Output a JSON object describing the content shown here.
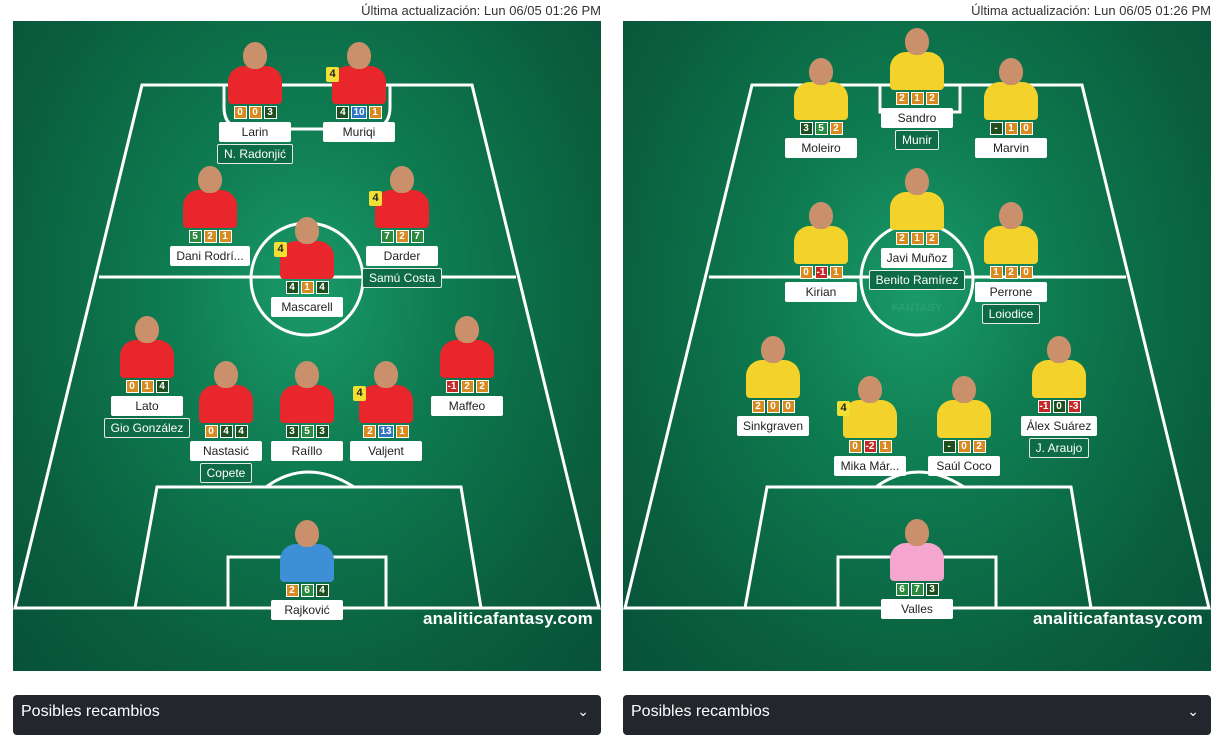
{
  "left_team": {
    "updated": "Última actualización: Lun 06/05 01:26 PM",
    "watermark": "analiticafantasy.com",
    "replacements_title": "Posibles recambios",
    "colors": {
      "shirt": "#e8262b",
      "gk_shirt": "#3d8fd6"
    },
    "players": [
      {
        "id": "larin",
        "name": "Larin",
        "stats": [
          "0",
          "0",
          "3"
        ],
        "classes": [
          "o",
          "o",
          "d"
        ],
        "alt": "N. Radonjić",
        "badge": "",
        "gk": false
      },
      {
        "id": "muriqi",
        "name": "Muriqi",
        "stats": [
          "4",
          "10",
          "1"
        ],
        "classes": [
          "d",
          "b",
          "o"
        ],
        "alt": "",
        "badge": "4",
        "gk": false
      },
      {
        "id": "dani",
        "name": "Dani Rodrí...",
        "stats": [
          "5",
          "2",
          "1"
        ],
        "classes": [
          "g",
          "o",
          "o"
        ],
        "alt": "",
        "badge": "",
        "gk": false
      },
      {
        "id": "darder",
        "name": "Darder",
        "stats": [
          "7",
          "2",
          "7"
        ],
        "classes": [
          "g",
          "o",
          "g"
        ],
        "alt": "Samú Costa",
        "badge": "4",
        "gk": false
      },
      {
        "id": "mascarell",
        "name": "Mascarell",
        "stats": [
          "4",
          "1",
          "4"
        ],
        "classes": [
          "d",
          "o",
          "d"
        ],
        "alt": "",
        "badge": "4",
        "gk": false
      },
      {
        "id": "lato",
        "name": "Lato",
        "stats": [
          "0",
          "1",
          "4"
        ],
        "classes": [
          "o",
          "o",
          "d"
        ],
        "alt": "Gio González",
        "badge": "",
        "gk": false
      },
      {
        "id": "maffeo",
        "name": "Maffeo",
        "stats": [
          "-1",
          "2",
          "2"
        ],
        "classes": [
          "r",
          "o",
          "o"
        ],
        "alt": "",
        "badge": "",
        "gk": false
      },
      {
        "id": "nastasic",
        "name": "Nastasić",
        "stats": [
          "0",
          "4",
          "4"
        ],
        "classes": [
          "o",
          "d",
          "d"
        ],
        "alt": "Copete",
        "badge": "",
        "gk": false
      },
      {
        "id": "raillo",
        "name": "Raíllo",
        "stats": [
          "3",
          "5",
          "3"
        ],
        "classes": [
          "d",
          "g",
          "d"
        ],
        "alt": "",
        "badge": "",
        "gk": false
      },
      {
        "id": "valjent",
        "name": "Valjent",
        "stats": [
          "2",
          "13",
          "1"
        ],
        "classes": [
          "o",
          "b",
          "o"
        ],
        "alt": "",
        "badge": "4",
        "gk": false
      },
      {
        "id": "rajkovic",
        "name": "Rajković",
        "stats": [
          "2",
          "6",
          "4"
        ],
        "classes": [
          "o",
          "g",
          "d"
        ],
        "alt": "",
        "badge": "",
        "gk": true
      }
    ]
  },
  "right_team": {
    "updated": "Última actualización: Lun 06/05 01:26 PM",
    "watermark": "analiticafantasy.com",
    "replacements_title": "Posibles recambios",
    "colors": {
      "shirt": "#f2d22b",
      "gk_shirt": "#f4a6cf"
    },
    "players": [
      {
        "id": "moleiro",
        "name": "Moleiro",
        "stats": [
          "3",
          "5",
          "2"
        ],
        "classes": [
          "d",
          "g",
          "o"
        ],
        "alt": "",
        "badge": "",
        "gk": false
      },
      {
        "id": "sandro",
        "name": "Sandro",
        "stats": [
          "2",
          "1",
          "2"
        ],
        "classes": [
          "o",
          "o",
          "o"
        ],
        "alt": "Munir",
        "badge": "",
        "gk": false
      },
      {
        "id": "marvin",
        "name": "Marvin",
        "stats": [
          "-",
          "1",
          "0"
        ],
        "classes": [
          "d",
          "o",
          "o"
        ],
        "alt": "",
        "badge": "",
        "gk": false
      },
      {
        "id": "kirian",
        "name": "Kirian",
        "stats": [
          "0",
          "-1",
          "1"
        ],
        "classes": [
          "o",
          "r",
          "o"
        ],
        "alt": "",
        "badge": "",
        "gk": false
      },
      {
        "id": "javi",
        "name": "Javi Muñoz",
        "stats": [
          "2",
          "1",
          "2"
        ],
        "classes": [
          "o",
          "o",
          "o"
        ],
        "alt": "Benito Ramírez",
        "badge": "",
        "gk": false
      },
      {
        "id": "perrone",
        "name": "Perrone",
        "stats": [
          "1",
          "2",
          "0"
        ],
        "classes": [
          "o",
          "o",
          "o"
        ],
        "alt": "Loiodice",
        "badge": "",
        "gk": false
      },
      {
        "id": "sinkgraven",
        "name": "Sinkgraven",
        "stats": [
          "2",
          "0",
          "0"
        ],
        "classes": [
          "o",
          "o",
          "o"
        ],
        "alt": "",
        "badge": "",
        "gk": false
      },
      {
        "id": "alex",
        "name": "Álex Suárez",
        "stats": [
          "-1",
          "0",
          "-3"
        ],
        "classes": [
          "r",
          "d",
          "r"
        ],
        "alt": "J. Araujo",
        "badge": "",
        "gk": false
      },
      {
        "id": "mika",
        "name": "Mika Már...",
        "stats": [
          "0",
          "-2",
          "1"
        ],
        "classes": [
          "o",
          "r",
          "o"
        ],
        "alt": "",
        "badge": "4",
        "gk": false
      },
      {
        "id": "saul",
        "name": "Saúl Coco",
        "stats": [
          "-",
          "0",
          "2"
        ],
        "classes": [
          "d",
          "o",
          "o"
        ],
        "alt": "",
        "badge": "",
        "gk": false
      },
      {
        "id": "valles",
        "name": "Valles",
        "stats": [
          "6",
          "7",
          "3"
        ],
        "classes": [
          "g",
          "g",
          "d"
        ],
        "alt": "",
        "badge": "",
        "gk": true
      }
    ]
  }
}
